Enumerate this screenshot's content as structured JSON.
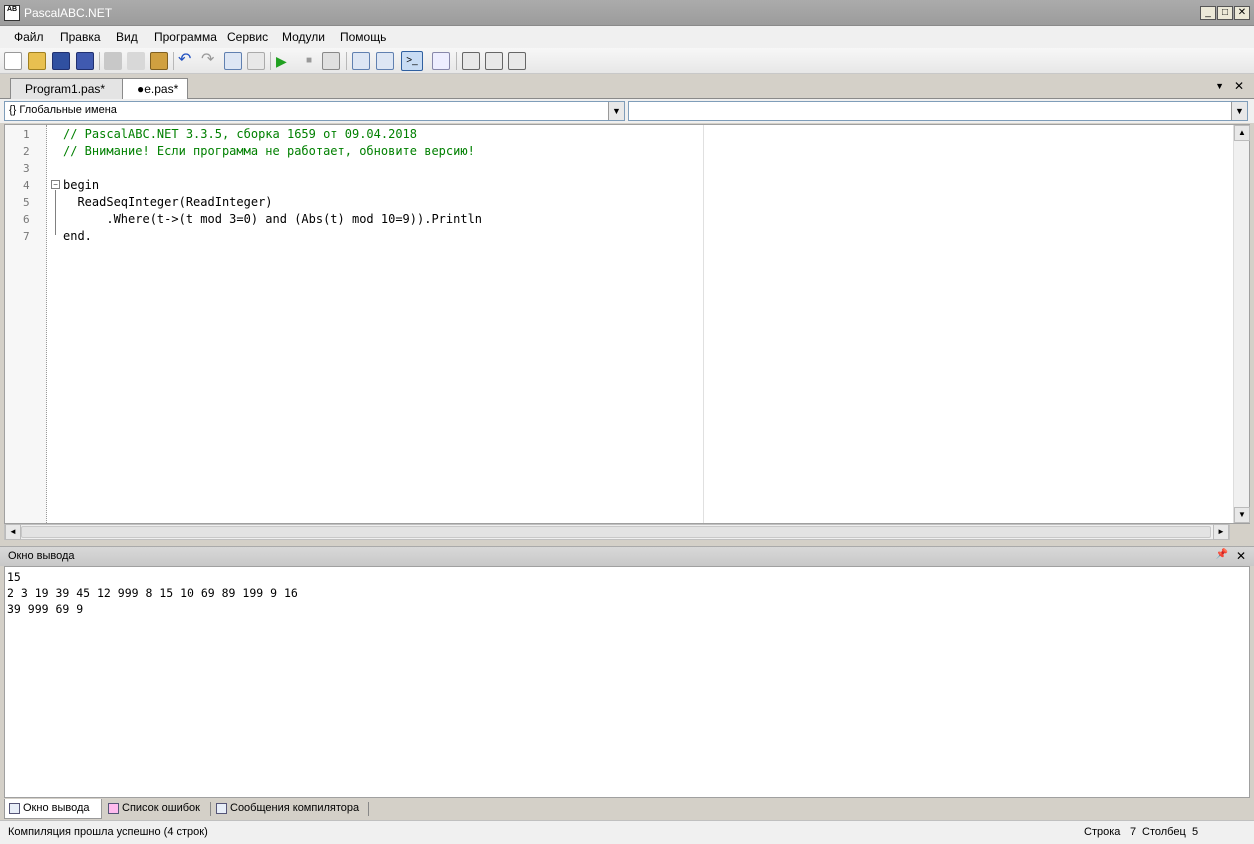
{
  "window": {
    "title": "PascalABC.NET",
    "icon_text": "AB",
    "minimize": "_",
    "maximize": "□",
    "close": "✕"
  },
  "menu": [
    "Файл",
    "Правка",
    "Вид",
    "Программа",
    "Сервис",
    "Модули",
    "Помощь"
  ],
  "toolbar_icons": [
    "new-file-icon",
    "open-folder-icon",
    "save-icon",
    "save-all-icon",
    "cut-icon",
    "copy-icon",
    "paste-icon",
    "undo-icon",
    "redo-icon",
    "comment-icon",
    "uncomment-icon",
    "run-icon",
    "stop-icon",
    "debug-icon",
    "step-into-icon",
    "step-over-icon",
    "console-icon",
    "format-icon",
    "form-designer-icon",
    "trace-icon",
    "reset-icon"
  ],
  "tabs": [
    {
      "label": "Program1.pas*",
      "active": false
    },
    {
      "label": "●e.pas*",
      "active": true
    }
  ],
  "tab_controls": {
    "dropdown": "▼",
    "close": "✕"
  },
  "navigation": {
    "scope_combo": "Глобальные имена",
    "scope_icon": "{}",
    "member_combo": "",
    "arrow": "▼"
  },
  "editor": {
    "line_numbers": [
      "1",
      "2",
      "3",
      "4",
      "5",
      "6",
      "7"
    ],
    "lines": {
      "l1": "// PascalABC.NET 3.3.5, сборка 1659 от 09.04.2018",
      "l2": "// Внимание! Если программа не работает, обновите версию!",
      "l3": "",
      "l4": "begin",
      "l5": "  ReadSeqInteger(ReadInteger)",
      "l6": "      .Where(t->(t mod 3=0) and (Abs(t) mod 10=9)).Println",
      "l7": "end."
    },
    "fold_open": "−"
  },
  "scroll": {
    "up": "▲",
    "down": "▼",
    "left": "◄",
    "right": "►"
  },
  "output_panel": {
    "title": "Окно вывода",
    "pin": "📌",
    "close": "✕",
    "lines": [
      "15",
      "2 3 19 39 45 12 999 8 15 10 69 89 199 9 16",
      "39 999 69 9"
    ]
  },
  "bottom_tabs": [
    {
      "label": "Окно вывода",
      "active": true
    },
    {
      "label": "Список ошибок",
      "active": false
    },
    {
      "label": "Сообщения компилятора",
      "active": false
    }
  ],
  "status": {
    "message": "Компиляция прошла успешно (4 строк)",
    "row_label": "Строка",
    "row": "7",
    "col_label": "Столбец",
    "col": "5"
  }
}
